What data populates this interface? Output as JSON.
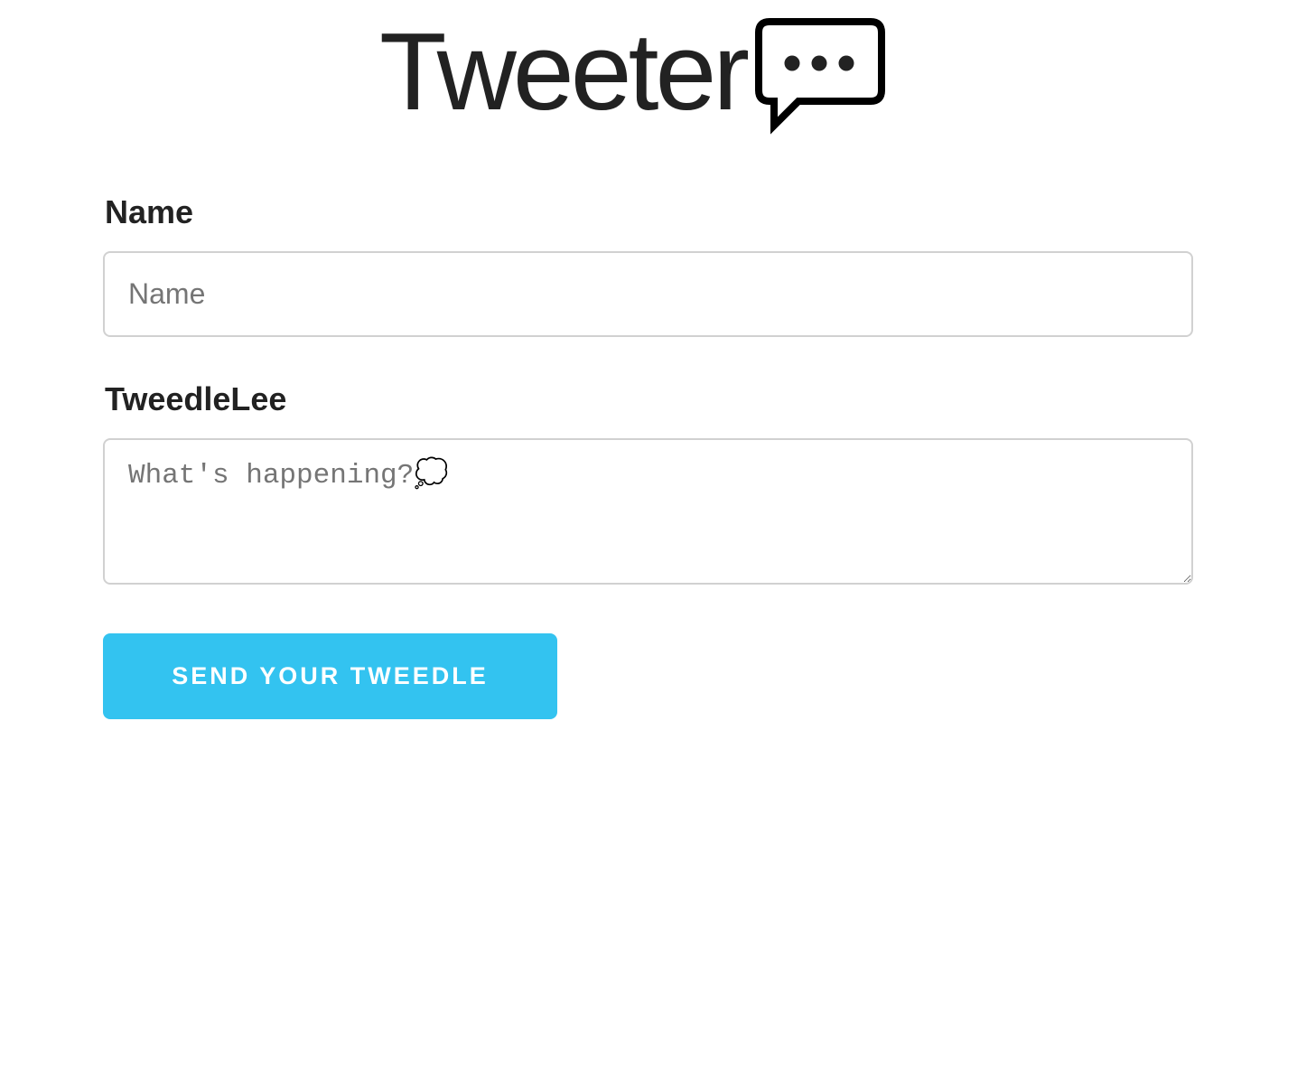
{
  "header": {
    "app_title": "Tweeter",
    "logo_icon": "speech-bubble-icon"
  },
  "form": {
    "name_label": "Name",
    "name_placeholder": "Name",
    "name_value": "",
    "tweet_label": "TweedleLee",
    "tweet_placeholder": "What's happening?💭",
    "tweet_value": "",
    "submit_label": "SEND YOUR TWEEDLE"
  },
  "colors": {
    "accent": "#33c3f0",
    "text": "#222222",
    "placeholder": "#757575",
    "border": "#d1d1d1"
  }
}
